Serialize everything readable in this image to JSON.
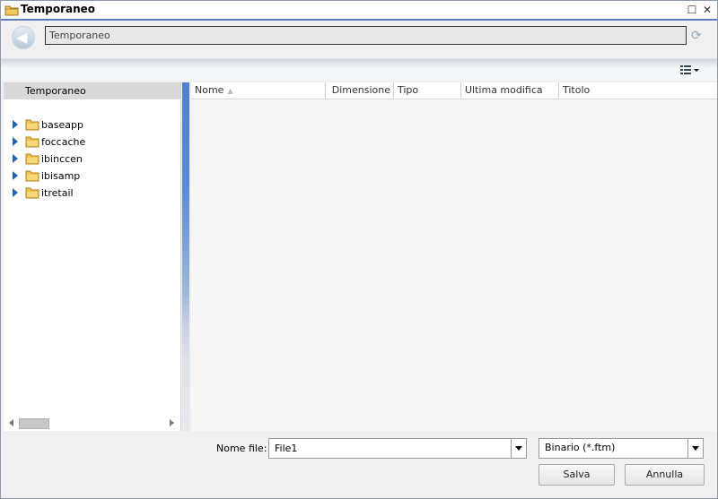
{
  "window": {
    "title": "Temporaneo"
  },
  "address": {
    "path": "Temporaneo"
  },
  "tree": {
    "header": "Temporaneo",
    "items": [
      {
        "label": "baseapp"
      },
      {
        "label": "foccache"
      },
      {
        "label": "ibinccen"
      },
      {
        "label": "ibisamp"
      },
      {
        "label": "itretail"
      }
    ]
  },
  "columns": {
    "name": "Nome",
    "size": "Dimensione",
    "type": "Tipo",
    "modified": "Ultima modifica",
    "title": "Titolo"
  },
  "footer": {
    "filename_label": "Nome file:",
    "filename_value": "File1",
    "filetype_value": "Binario (*.ftm)",
    "save_label": "Salva",
    "cancel_label": "Annulla"
  },
  "colors": {
    "accent": "#5a7ec0",
    "tree_arrow": "#1e66b5",
    "folder": "#e8b64a"
  }
}
